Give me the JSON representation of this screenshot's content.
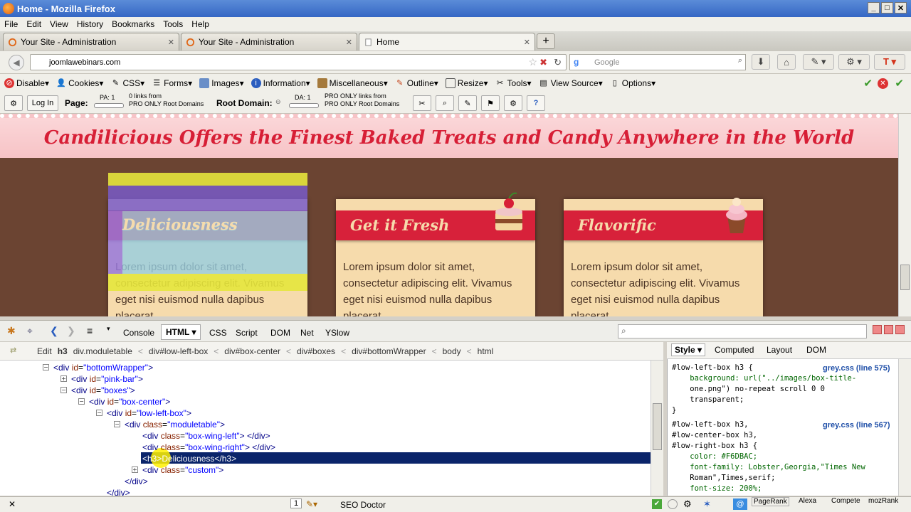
{
  "window": {
    "title": "Home - Mozilla Firefox"
  },
  "menu": [
    "File",
    "Edit",
    "View",
    "History",
    "Bookmarks",
    "Tools",
    "Help"
  ],
  "tabs": [
    {
      "label": "Your Site - Administration"
    },
    {
      "label": "Your Site - Administration"
    },
    {
      "label": "Home"
    }
  ],
  "url": "joomlawebinars.com",
  "search": {
    "placeholder": "Google"
  },
  "webdev": [
    "Disable",
    "Cookies",
    "CSS",
    "Forms",
    "Images",
    "Information",
    "Miscellaneous",
    "Outline",
    "Resize",
    "Tools",
    "View Source",
    "Options"
  ],
  "seo": {
    "login": "Log In",
    "page_label": "Page:",
    "pa": "PA: 1",
    "page_links_1": "0 links from",
    "page_links_2": "PRO ONLY Root Domains",
    "root_label": "Root Domain:",
    "da": "DA: 1",
    "root_links_1": "PRO ONLY links from",
    "root_links_2": "PRO ONLY Root Domains"
  },
  "site": {
    "banner": "Candilicious Offers the Finest Baked Treats and Candy Anywhere in the World",
    "boxes": [
      {
        "title": "Deliciousness",
        "body": "Lorem ipsum dolor sit amet, consectetur adipiscing elit. Vivamus eget nisi euismod nulla dapibus placerat"
      },
      {
        "title": "Get it Fresh",
        "body": "Lorem ipsum dolor sit amet, consectetur adipiscing elit. Vivamus eget nisi euismod nulla dapibus placerat"
      },
      {
        "title": "Flavorific",
        "body": "Lorem ipsum dolor sit amet, consectetur adipiscing elit. Vivamus eget nisi euismod nulla dapibus placerat"
      }
    ]
  },
  "firebug": {
    "tabs": [
      "Console",
      "HTML",
      "CSS",
      "Script",
      "DOM",
      "Net",
      "YSlow"
    ],
    "crumbs": [
      "Edit",
      "h3",
      "div.moduletable",
      "div#low-left-box",
      "div#box-center",
      "div#boxes",
      "div#bottomWrapper",
      "body",
      "html"
    ],
    "side_tabs": [
      "Style",
      "Computed",
      "Layout",
      "DOM"
    ],
    "tree": [
      {
        "tw": "-",
        "tag": "div",
        "attr": "id",
        "val": "bottomWrapper",
        "end": ">"
      },
      {
        "tw": "+",
        "tag": "div",
        "attr": "id",
        "val": "pink-bar",
        "end": ">"
      },
      {
        "tw": "-",
        "tag": "div",
        "attr": "id",
        "val": "boxes",
        "end": ">"
      },
      {
        "tw": "-",
        "tag": "div",
        "attr": "id",
        "val": "box-center",
        "end": ">"
      },
      {
        "tw": "-",
        "tag": "div",
        "attr": "id",
        "val": "low-left-box",
        "end": ">"
      },
      {
        "tw": "-",
        "tag": "div",
        "attr": "class",
        "val": "moduletable",
        "end": ">"
      },
      {
        "tw": "",
        "tag": "div",
        "attr": "class",
        "val": "box-wing-left",
        "end": "> </div>"
      },
      {
        "tw": "",
        "tag": "div",
        "attr": "class",
        "val": "box-wing-right",
        "end": "> </div>"
      },
      {
        "tw": "",
        "tag": "h3",
        "text": "<h3>Deliciousness</h3>"
      },
      {
        "tw": "+",
        "tag": "div",
        "attr": "class",
        "val": "custom",
        "end": ">"
      },
      {
        "tw": "",
        "text": "</div>"
      },
      {
        "tw": "",
        "text": "</div>"
      }
    ],
    "css1": {
      "source": "grey.css (line 575)",
      "lines": [
        "#low-left-box h3 {",
        "    background: url(\"../images/box-title-",
        "    one.png\") no-repeat scroll 0 0",
        "    transparent;",
        "}"
      ]
    },
    "css2": {
      "source": "grey.css (line 567)",
      "lines": [
        "#low-left-box h3,",
        "#low-center-box h3,",
        "#low-right-box h3 {",
        "    color: #F6DBAC;",
        "    font-family: Lobster,Georgia,\"Times New",
        "    Roman\",Times,serif;",
        "    font-size: 200%;"
      ]
    }
  },
  "status": {
    "page_num": "1",
    "seo_doctor": "SEO Doctor",
    "pagerank": "PageRank",
    "alexa": "Alexa",
    "compete": "Compete",
    "mozrank": "mozRank"
  }
}
